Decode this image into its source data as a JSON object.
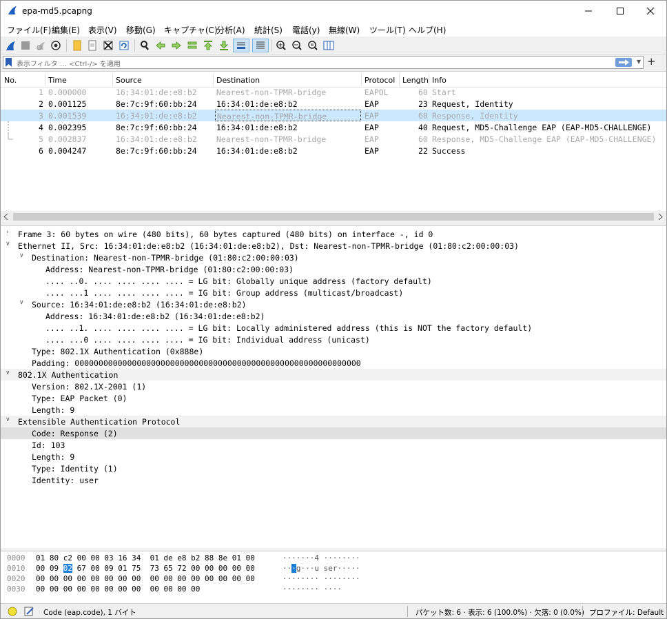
{
  "window": {
    "title": "epa-md5.pcapng"
  },
  "menu": [
    "ファイル(F)",
    "編集(E)",
    "表示(V)",
    "移動(G)",
    "キャプチャ(C)",
    "分析(A)",
    "統計(S)",
    "電話(y)",
    "無線(W)",
    "ツール(T)",
    "ヘルプ(H)"
  ],
  "filter": {
    "placeholder": "表示フィルタ … <Ctrl-/> を適用"
  },
  "columns": [
    "No.",
    "Time",
    "Source",
    "Destination",
    "Protocol",
    "Length",
    "Info"
  ],
  "packets": [
    {
      "no": "1",
      "time": "0.000000",
      "source": "16:34:01:de:e8:b2",
      "destination": "Nearest-non-TPMR-bridge",
      "protocol": "EAPOL",
      "length": "60",
      "info": "Start"
    },
    {
      "no": "2",
      "time": "0.001125",
      "source": "8e:7c:9f:60:bb:24",
      "destination": "16:34:01:de:e8:b2",
      "protocol": "EAP",
      "length": "23",
      "info": "Request, Identity"
    },
    {
      "no": "3",
      "time": "0.001539",
      "source": "16:34:01:de:e8:b2",
      "destination": "Nearest-non-TPMR-bridge",
      "protocol": "EAP",
      "length": "60",
      "info": "Response, Identity"
    },
    {
      "no": "4",
      "time": "0.002395",
      "source": "8e:7c:9f:60:bb:24",
      "destination": "16:34:01:de:e8:b2",
      "protocol": "EAP",
      "length": "40",
      "info": "Request, MD5-Challenge EAP (EAP-MD5-CHALLENGE)"
    },
    {
      "no": "5",
      "time": "0.002837",
      "source": "16:34:01:de:e8:b2",
      "destination": "Nearest-non-TPMR-bridge",
      "protocol": "EAP",
      "length": "60",
      "info": "Response, MD5-Challenge EAP (EAP-MD5-CHALLENGE)"
    },
    {
      "no": "6",
      "time": "0.004247",
      "source": "8e:7c:9f:60:bb:24",
      "destination": "16:34:01:de:e8:b2",
      "protocol": "EAP",
      "length": "22",
      "info": "Success"
    }
  ],
  "details": [
    "Frame 3: 60 bytes on wire (480 bits), 60 bytes captured (480 bits) on interface -, id 0",
    "Ethernet II, Src: 16:34:01:de:e8:b2 (16:34:01:de:e8:b2), Dst: Nearest-non-TPMR-bridge (01:80:c2:00:00:03)",
    "Destination: Nearest-non-TPMR-bridge (01:80:c2:00:00:03)",
    "Address: Nearest-non-TPMR-bridge (01:80:c2:00:00:03)",
    ".... ..0. .... .... .... .... = LG bit: Globally unique address (factory default)",
    ".... ...1 .... .... .... .... = IG bit: Group address (multicast/broadcast)",
    "Source: 16:34:01:de:e8:b2 (16:34:01:de:e8:b2)",
    "Address: 16:34:01:de:e8:b2 (16:34:01:de:e8:b2)",
    ".... ..1. .... .... .... .... = LG bit: Locally administered address (this is NOT the factory default)",
    ".... ...0 .... .... .... .... = IG bit: Individual address (unicast)",
    "Type: 802.1X Authentication (0x888e)",
    "Padding: 000000000000000000000000000000000000000000000000000000000000",
    "802.1X Authentication",
    "Version: 802.1X-2001 (1)",
    "Type: EAP Packet (0)",
    "Length: 9",
    "Extensible Authentication Protocol",
    "Code: Response (2)",
    "Id: 103",
    "Length: 9",
    "Type: Identity (1)",
    "Identity: user"
  ],
  "hex": [
    {
      "offset": "0000",
      "b1": "01 80 c2 00 00 03 16 34",
      "b2": "01 de e8 b2 88 8e 01 00",
      "ascii": "·······4 ········"
    },
    {
      "offset": "0010",
      "pre": "00 09 ",
      "sel": "02",
      "post": " 67 00 09 01 75  73 65 72 00 00 00 00 00",
      "apre": "··",
      "asel": "·",
      "apost": "g···u ser·····"
    },
    {
      "offset": "0020",
      "b1": "00 00 00 00 00 00 00 00",
      "b2": "00 00 00 00 00 00 00 00",
      "ascii": "········ ········"
    },
    {
      "offset": "0030",
      "b1": "00 00 00 00 00 00 00 00",
      "b2": "00 00 00 00",
      "ascii": "········ ····"
    }
  ],
  "status": {
    "field": "Code (eap.code), 1 バイト",
    "packets": "パケット数: 6 · 表示: 6 (100.0%) · 欠落: 0 (0.0%)",
    "profile": "プロファイル: Default"
  }
}
